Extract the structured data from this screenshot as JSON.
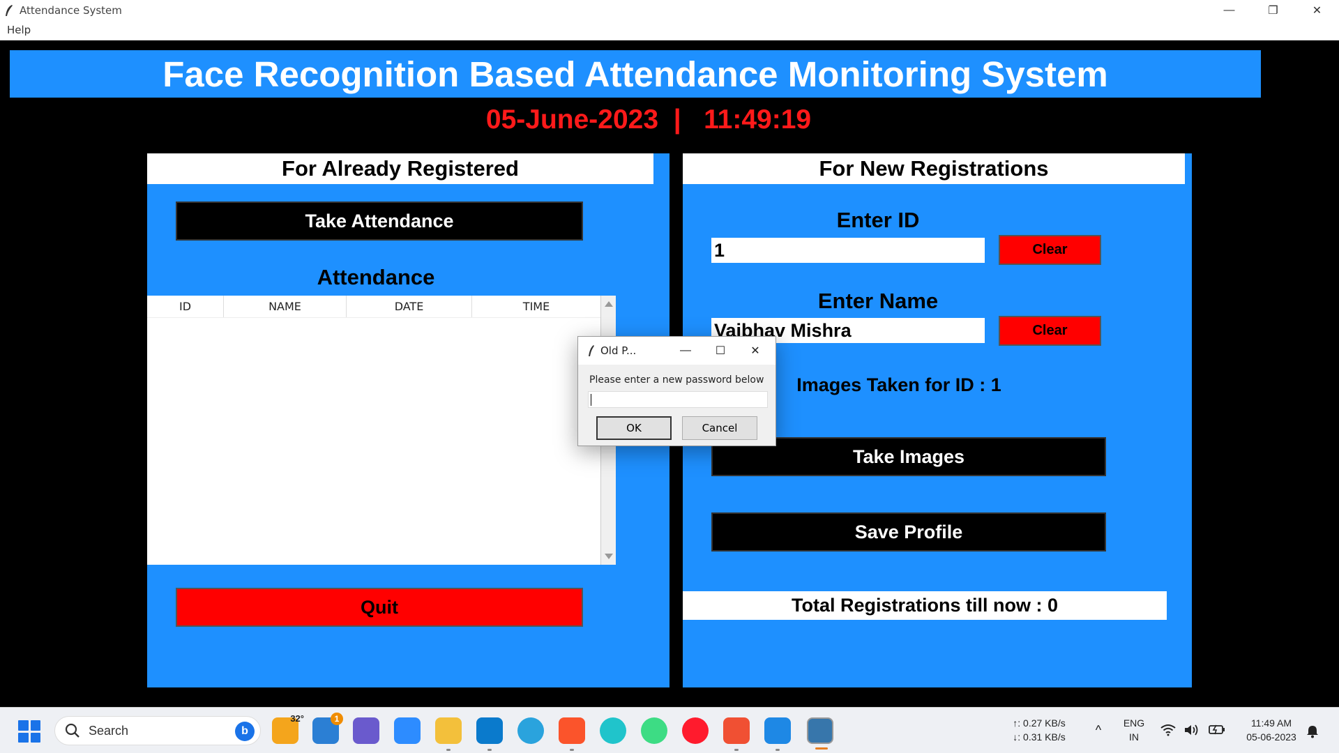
{
  "window": {
    "title": "Attendance System",
    "controls": {
      "minimize": "—",
      "restore": "❐",
      "close": "✕"
    }
  },
  "menu": {
    "help": "Help"
  },
  "header": {
    "title": "Face Recognition Based Attendance Monitoring System",
    "datetime": "05-June-2023  |   11:49:19"
  },
  "left_panel": {
    "heading": "For Already Registered",
    "take_attendance": "Take Attendance",
    "attendance_label": "Attendance",
    "table_columns": [
      "ID",
      "NAME",
      "DATE",
      "TIME"
    ],
    "quit": "Quit"
  },
  "right_panel": {
    "heading": "For New Registrations",
    "enter_id_label": "Enter ID",
    "id_value": "1",
    "clear_label": "Clear",
    "enter_name_label": "Enter Name",
    "name_value": "Vaibhav Mishra",
    "images_taken": "Images Taken for ID : 1",
    "take_images": "Take Images",
    "save_profile": "Save Profile",
    "total_registrations": "Total Registrations till now  : 0"
  },
  "dialog": {
    "title": "Old P...",
    "message": "Please enter a new password below",
    "input_value": "",
    "ok": "OK",
    "cancel": "Cancel",
    "controls": {
      "minimize": "—",
      "maximize": "☐",
      "close": "✕"
    }
  },
  "taskbar": {
    "search_label": "Search",
    "weather_temp": "32°",
    "mail_badge": "1",
    "net_up": "↑: 0.27 KB/s",
    "net_down": "↓: 0.31 KB/s",
    "lang_top": "ENG",
    "lang_bottom": "IN",
    "time": "11:49 AM",
    "date": "05-06-2023",
    "apps": [
      "weather",
      "mail",
      "copilot",
      "zoom",
      "file-explorer",
      "vscode",
      "telegram",
      "brave",
      "canva",
      "android-studio",
      "opera",
      "git",
      "notepad",
      "python"
    ]
  },
  "colors": {
    "panel_blue": "#1e90ff",
    "accent_red": "#ff0000",
    "clock_red": "#ff1a1a",
    "background": "#000000"
  }
}
